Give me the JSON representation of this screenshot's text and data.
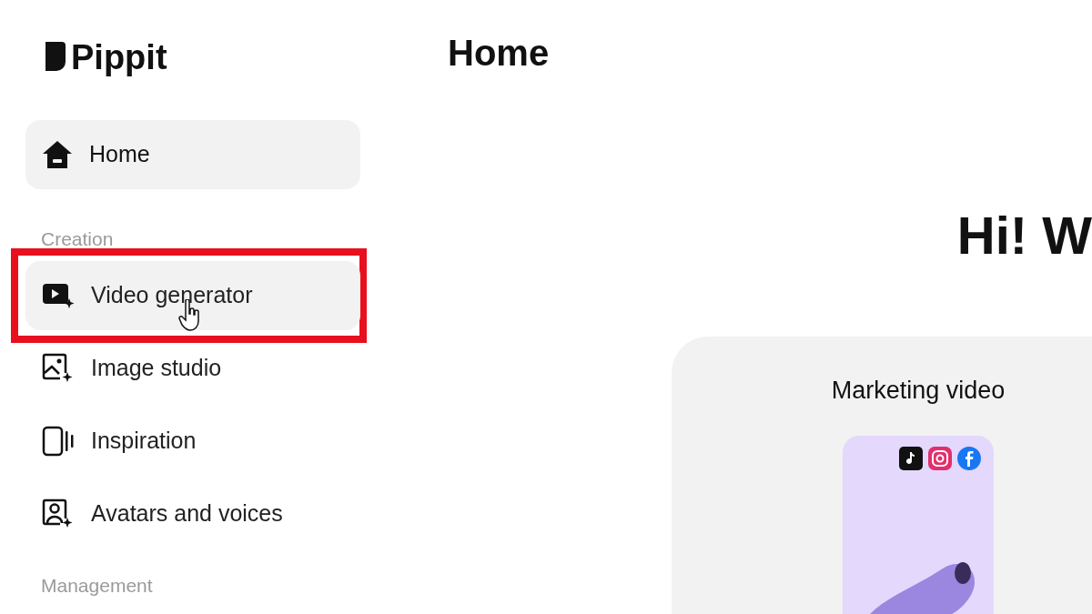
{
  "app": {
    "name": "Pippit"
  },
  "sidebar": {
    "top_items": [
      {
        "label": "Home",
        "selected": true,
        "hovered": false,
        "annotated": false
      }
    ],
    "sections": [
      {
        "title": "Creation",
        "items": [
          {
            "label": "Video generator",
            "selected": false,
            "hovered": true,
            "annotated": true
          },
          {
            "label": "Image studio",
            "selected": false,
            "hovered": false,
            "annotated": false
          },
          {
            "label": "Inspiration",
            "selected": false,
            "hovered": false,
            "annotated": false
          },
          {
            "label": "Avatars and voices",
            "selected": false,
            "hovered": false,
            "annotated": false
          }
        ]
      },
      {
        "title": "Management"
      }
    ]
  },
  "main": {
    "title": "Home",
    "greeting": "Hi! W",
    "card": {
      "title": "Marketing video"
    }
  }
}
